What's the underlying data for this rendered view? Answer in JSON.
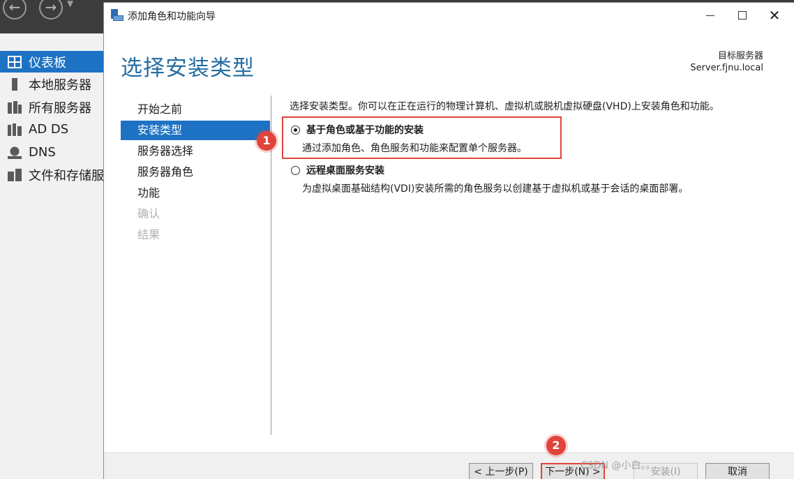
{
  "background": {
    "nav": [
      {
        "label": "仪表板",
        "icon": "dashboard-icon",
        "active": true
      },
      {
        "label": "本地服务器",
        "icon": "server-icon"
      },
      {
        "label": "所有服务器",
        "icon": "servers-icon"
      },
      {
        "label": "AD DS",
        "icon": "ad-ds-icon"
      },
      {
        "label": "DNS",
        "icon": "dns-icon"
      },
      {
        "label": "文件和存储服",
        "icon": "file-storage-icon"
      }
    ]
  },
  "wizard": {
    "title": "添加角色和功能向导",
    "page_title": "选择安装类型",
    "target_label": "目标服务器",
    "target_server": "Server.fjnu.local",
    "steps": [
      {
        "label": "开始之前",
        "state": "normal"
      },
      {
        "label": "安装类型",
        "state": "active"
      },
      {
        "label": "服务器选择",
        "state": "normal"
      },
      {
        "label": "服务器角色",
        "state": "normal"
      },
      {
        "label": "功能",
        "state": "normal"
      },
      {
        "label": "确认",
        "state": "disabled"
      },
      {
        "label": "结果",
        "state": "disabled"
      }
    ],
    "description": "选择安装类型。你可以在正在运行的物理计算机、虚拟机或脱机虚拟硬盘(VHD)上安装角色和功能。",
    "options": [
      {
        "label": "基于角色或基于功能的安装",
        "desc": "通过添加角色、角色服务和功能来配置单个服务器。",
        "checked": true
      },
      {
        "label": "远程桌面服务安装",
        "desc": "为虚拟桌面基础结构(VDI)安装所需的角色服务以创建基于虚拟机或基于会话的桌面部署。",
        "checked": false
      }
    ],
    "buttons": {
      "prev": "< 上一步(P)",
      "next": "下一步(N) >",
      "install": "安装(I)",
      "cancel": "取消"
    }
  },
  "annotations": {
    "badge1": "1",
    "badge2": "2",
    "color": "#e0443a"
  },
  "watermark": "CSDN @小白。。",
  "colors": {
    "accent": "#1e72c4",
    "title": "#246ea3",
    "topbar": "#3c3c3c"
  }
}
